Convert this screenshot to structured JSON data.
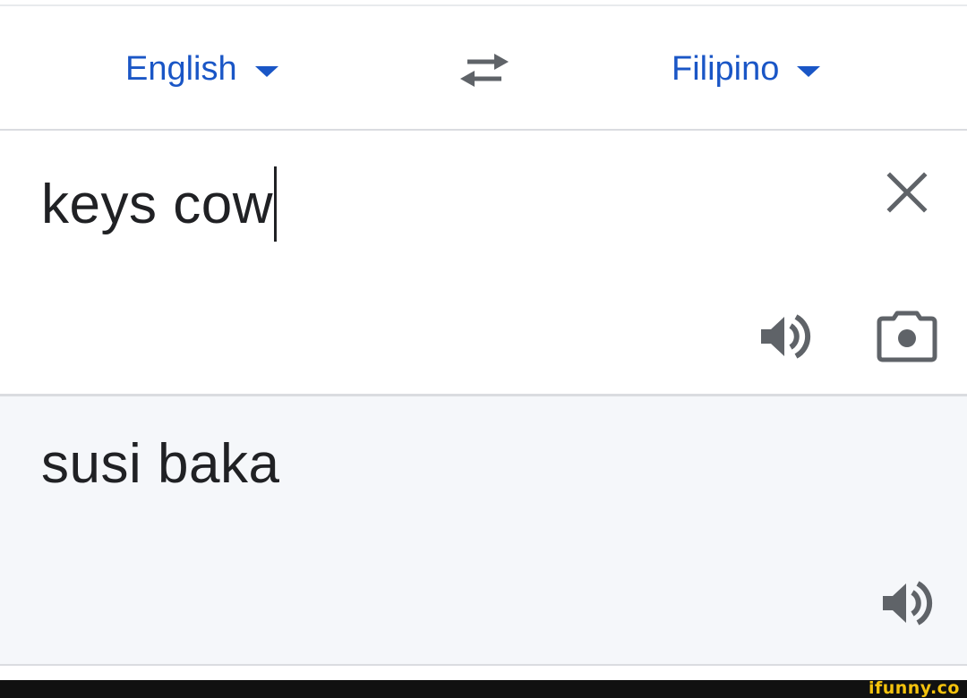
{
  "language_bar": {
    "source_language": "English",
    "target_language": "Filipino",
    "swap_icon": "swap-arrows-icon"
  },
  "input": {
    "text": "keys cow",
    "clear_icon": "close-icon",
    "speak_icon": "speaker-icon",
    "camera_icon": "camera-icon"
  },
  "output": {
    "text": "susi baka",
    "speak_icon": "speaker-icon"
  },
  "watermark": {
    "text": "ifunny.co"
  },
  "colors": {
    "accent": "#1a56c6",
    "text": "#202124",
    "icon": "#5f6368",
    "output_bg": "#f5f7fa",
    "divider": "#dadce0",
    "watermark": "#f4c20d"
  }
}
